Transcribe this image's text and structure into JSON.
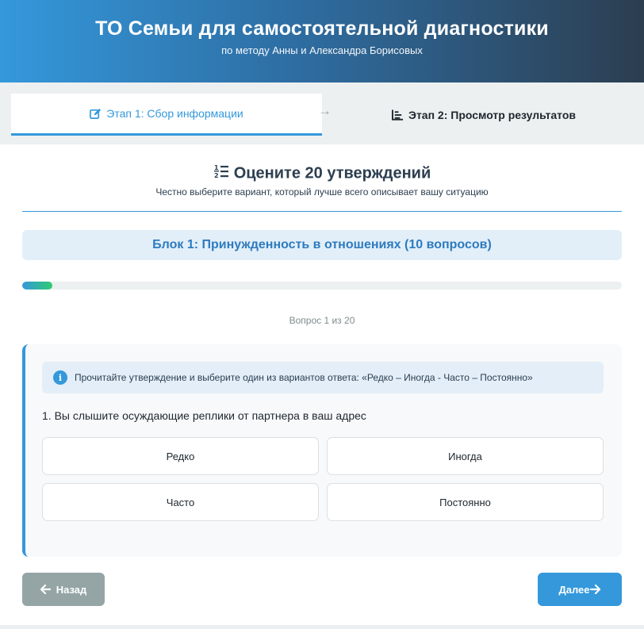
{
  "header": {
    "title": "ТО Семьи для самостоятельной диагностики",
    "subtitle": "по методу Анны и Александра Борисовых"
  },
  "steps": {
    "step1": {
      "label": "Этап 1: Сбор информации",
      "icon": "edit-icon"
    },
    "separator": "→",
    "step2": {
      "label": "Этап 2: Просмотр результатов",
      "icon": "chart-icon"
    }
  },
  "main": {
    "title": "Оцените 20 утверждений",
    "title_icon": "list-ol-icon",
    "subtitle": "Честно выберите вариант, который лучше всего описывает вашу ситуацию",
    "block_title": "Блок 1: Принужденность в отношениях (10 вопросов)",
    "progress_fraction": 0.05,
    "counter": "Вопрос 1 из 20"
  },
  "question": {
    "hint": "Прочитайте утверждение и выберите один из вариантов ответа: «Редко – Иногда - Часто – Постоянно»",
    "text": "1. Вы слышите осуждающие реплики от партнера в ваш адрес",
    "options": [
      "Редко",
      "Иногда",
      "Часто",
      "Постоянно"
    ]
  },
  "nav": {
    "back_label": "Назад",
    "next_label": "Далее"
  },
  "colors": {
    "primary": "#3498db",
    "dark": "#2c3e50",
    "accent_green": "#2ecc71",
    "gray_button": "#95a5a6"
  }
}
